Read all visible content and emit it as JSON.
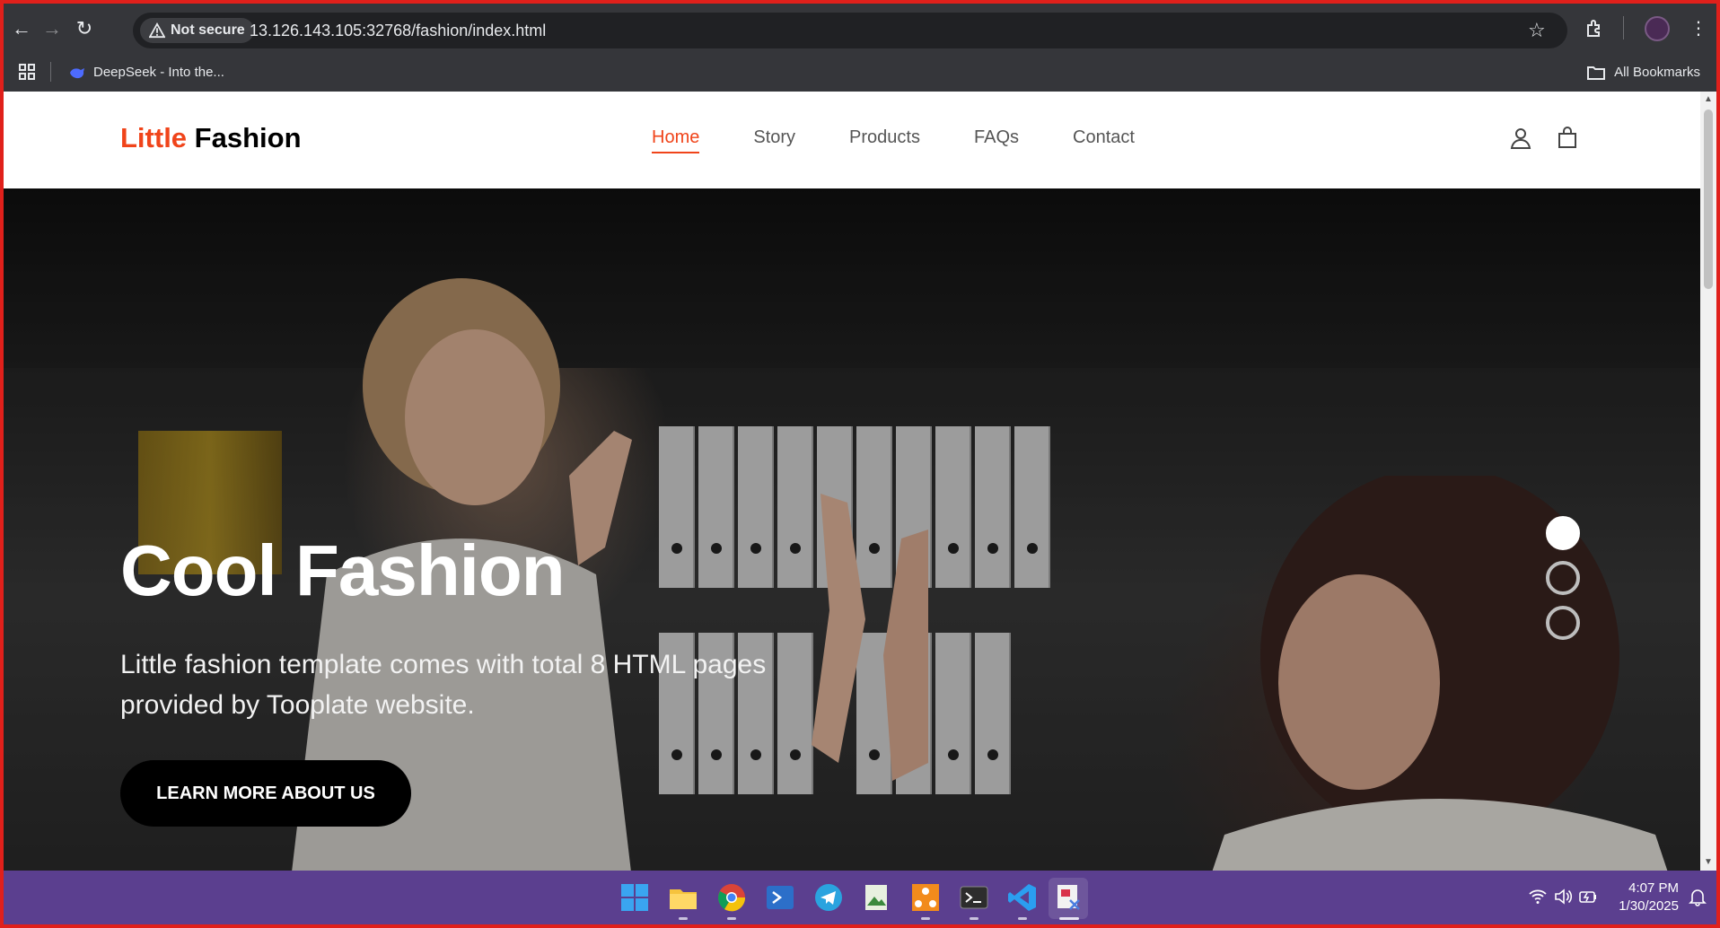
{
  "browser": {
    "not_secure_label": "Not secure",
    "url": "13.126.143.105:32768/fashion/index.html",
    "bookmark_item": "DeepSeek - Into the...",
    "all_bookmarks": "All Bookmarks"
  },
  "site": {
    "brand_accent": "Little",
    "brand_rest": " Fashion",
    "nav": [
      {
        "label": "Home",
        "active": true
      },
      {
        "label": "Story"
      },
      {
        "label": "Products"
      },
      {
        "label": "FAQs"
      },
      {
        "label": "Contact"
      }
    ],
    "icons": [
      "user-icon",
      "shopping-bag-icon"
    ]
  },
  "hero": {
    "title": "Cool Fashion",
    "subtitle": "Little fashion template comes with total 8 HTML pages provided by Tooplate website.",
    "cta_label": "LEARN MORE ABOUT US",
    "carousel_slides": 3,
    "active_slide": 1
  },
  "taskbar": {
    "time": "4:07 PM",
    "date": "1/30/2025"
  },
  "colors": {
    "accent": "#f0441a",
    "taskbar": "#5b3f8f",
    "browser_chrome": "#35363a"
  }
}
